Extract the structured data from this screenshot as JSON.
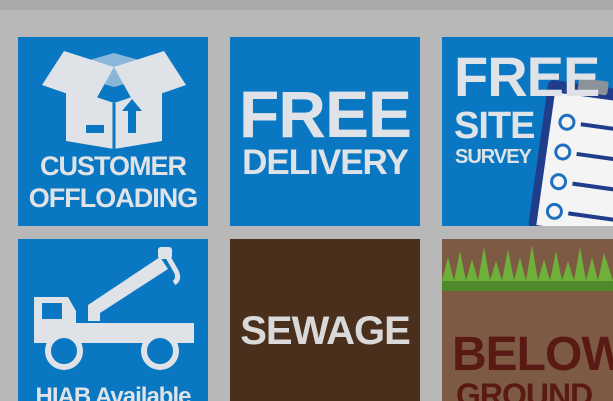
{
  "tiles": {
    "customer_offloading": {
      "line1": "CUSTOMER",
      "line2": "OFFLOADING"
    },
    "free_delivery": {
      "line1": "FREE",
      "line2": "DELIVERY"
    },
    "free_site_survey": {
      "line1": "FREE",
      "line2": "SITE",
      "line3": "SURVEY"
    },
    "hiab": {
      "label": "HIAB Available"
    },
    "sewage": {
      "label": "SEWAGE"
    },
    "below_ground": {
      "line1": "BELOW",
      "line2": "GROUND"
    }
  },
  "colors": {
    "page_bg": "#b8b8b8",
    "tile_blue": "#0a77c2",
    "tile_brown": "#4a2f1c",
    "tile_soil": "#7d5a43",
    "grass": "#4e8a2c",
    "label_light": "#dfe3e7",
    "label_dark_red": "#5a1a14"
  },
  "icons": [
    "box-icon",
    "clipboard-checklist-icon",
    "hiab-truck-icon",
    "grass-icon"
  ]
}
